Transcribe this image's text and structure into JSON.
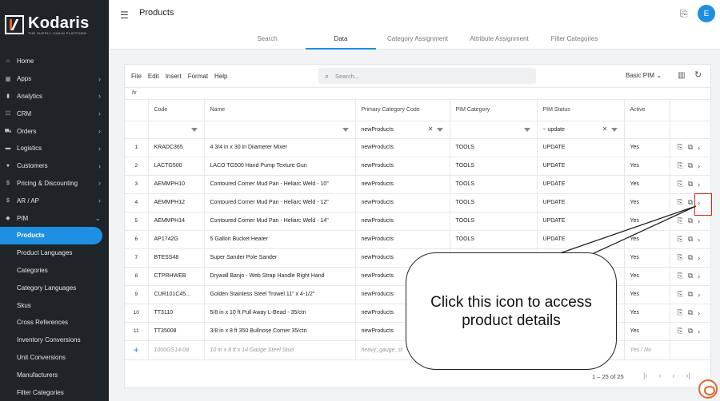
{
  "app": {
    "logo_name": "Kodaris",
    "logo_tagline": "THE SUPPLY CHAIN PLATFORM",
    "accent_color": "#1e8fe1",
    "brand_color": "#e8632a"
  },
  "header": {
    "title": "Products",
    "avatar_initial": "E"
  },
  "tabs": [
    {
      "label": "Search"
    },
    {
      "label": "Data"
    },
    {
      "label": "Category Assignment"
    },
    {
      "label": "Attribute Assignment"
    },
    {
      "label": "Filter Categories"
    }
  ],
  "sidebar": {
    "items": [
      {
        "label": "Home",
        "icon": "home-icon"
      },
      {
        "label": "Apps",
        "icon": "grid-icon"
      },
      {
        "label": "Analytics",
        "icon": "chart-icon"
      },
      {
        "label": "CRM",
        "icon": "crm-icon"
      },
      {
        "label": "Orders",
        "icon": "cart-icon"
      },
      {
        "label": "Logistics",
        "icon": "truck-icon"
      },
      {
        "label": "Customers",
        "icon": "people-icon"
      },
      {
        "label": "Pricing & Discounting",
        "icon": "dollar-icon"
      },
      {
        "label": "AR / AP",
        "icon": "dollar-icon"
      },
      {
        "label": "PIM",
        "icon": "tag-icon"
      }
    ],
    "sub_items": [
      {
        "label": "Products"
      },
      {
        "label": "Product Languages"
      },
      {
        "label": "Categories"
      },
      {
        "label": "Category Languages"
      },
      {
        "label": "Skus"
      },
      {
        "label": "Cross References"
      },
      {
        "label": "Inventory Conversions"
      },
      {
        "label": "Unit Conversions"
      },
      {
        "label": "Manufacturers"
      },
      {
        "label": "Filter Categories"
      }
    ]
  },
  "toolbar": {
    "menu": [
      "File",
      "Edit",
      "Insert",
      "Format",
      "Help"
    ],
    "search_placeholder": "Search...",
    "view_label": "Basic PIM",
    "fx_label": "fx"
  },
  "table": {
    "columns": [
      "Code",
      "Name",
      "Primary Category Code",
      "PIM Category",
      "PIM Status",
      "Active"
    ],
    "filters": {
      "primary_category": "newProducts",
      "pim_status": "~ update"
    },
    "rows": [
      {
        "num": "1",
        "code": "KRADC365",
        "name": "4 3/4 in x 30 in Diiameter Mixer",
        "primary": "newProducts",
        "category": "TOOLS",
        "status": "UPDATE",
        "active": "Yes"
      },
      {
        "num": "2",
        "code": "LACTG500",
        "name": "LACO TG500 Hand Pump Texture Gun",
        "primary": "newProducts",
        "category": "TOOLS",
        "status": "UPDATE",
        "active": "Yes"
      },
      {
        "num": "3",
        "code": "AEMMPH10",
        "name": "Contoured Corner Mud Pan - Heliarc Weld - 10\"",
        "primary": "newProducts",
        "category": "TOOLS",
        "status": "UPDATE",
        "active": "Yes"
      },
      {
        "num": "4",
        "code": "AEMMPH12",
        "name": "Contoured Corner Mud Pan - Heliarc Weld - 12\"",
        "primary": "newProducts",
        "category": "TOOLS",
        "status": "UPDATE",
        "active": "Yes"
      },
      {
        "num": "5",
        "code": "AEMMPH14",
        "name": "Contoured Corner Mud Pan - Heliarc Weld - 14\"",
        "primary": "newProducts",
        "category": "TOOLS",
        "status": "UPDATE",
        "active": "Yes"
      },
      {
        "num": "6",
        "code": "AP1742G",
        "name": "5 Gallon Bucket Heater",
        "primary": "newProducts",
        "category": "TOOLS",
        "status": "UPDATE",
        "active": "Yes"
      },
      {
        "num": "7",
        "code": "BTESS48",
        "name": "Super Sander Pole Sander",
        "primary": "newProducts",
        "category": "",
        "status": "",
        "active": "Yes"
      },
      {
        "num": "8",
        "code": "CTPRHWEB",
        "name": "Drywall Banjo - Web Strap Handle Right Hand",
        "primary": "newProducts",
        "category": "",
        "status": "",
        "active": "Yes"
      },
      {
        "num": "9",
        "code": "CUR101C45...",
        "name": "Golden Stainless Steel Trowel 11\" x 4-1/2\"",
        "primary": "newProducts",
        "category": "",
        "status": "",
        "active": "Yes"
      },
      {
        "num": "10",
        "code": "TT3110",
        "name": "5/8 in x 10 ft Pull Away L-Bead - 35/ctn",
        "primary": "newProducts",
        "category": "",
        "status": "",
        "active": "Yes"
      },
      {
        "num": "11",
        "code": "TT35008",
        "name": "3/8 in x 8 ft 350 Bullnose Corner 35/ctn",
        "primary": "newProducts",
        "category": "",
        "status": "",
        "active": "Yes"
      }
    ],
    "new_row": {
      "plus": "+",
      "code": "1000GS14-08",
      "name": "10 in x 8 ft x 14 Gauge Steel Stud",
      "primary": "heavy_gauge_st",
      "active": "Yes / No"
    }
  },
  "pager": {
    "range": "1 – 25 of 25"
  },
  "annotation": {
    "text": "Click this icon to access product details",
    "highlight_color": "#e02020"
  }
}
